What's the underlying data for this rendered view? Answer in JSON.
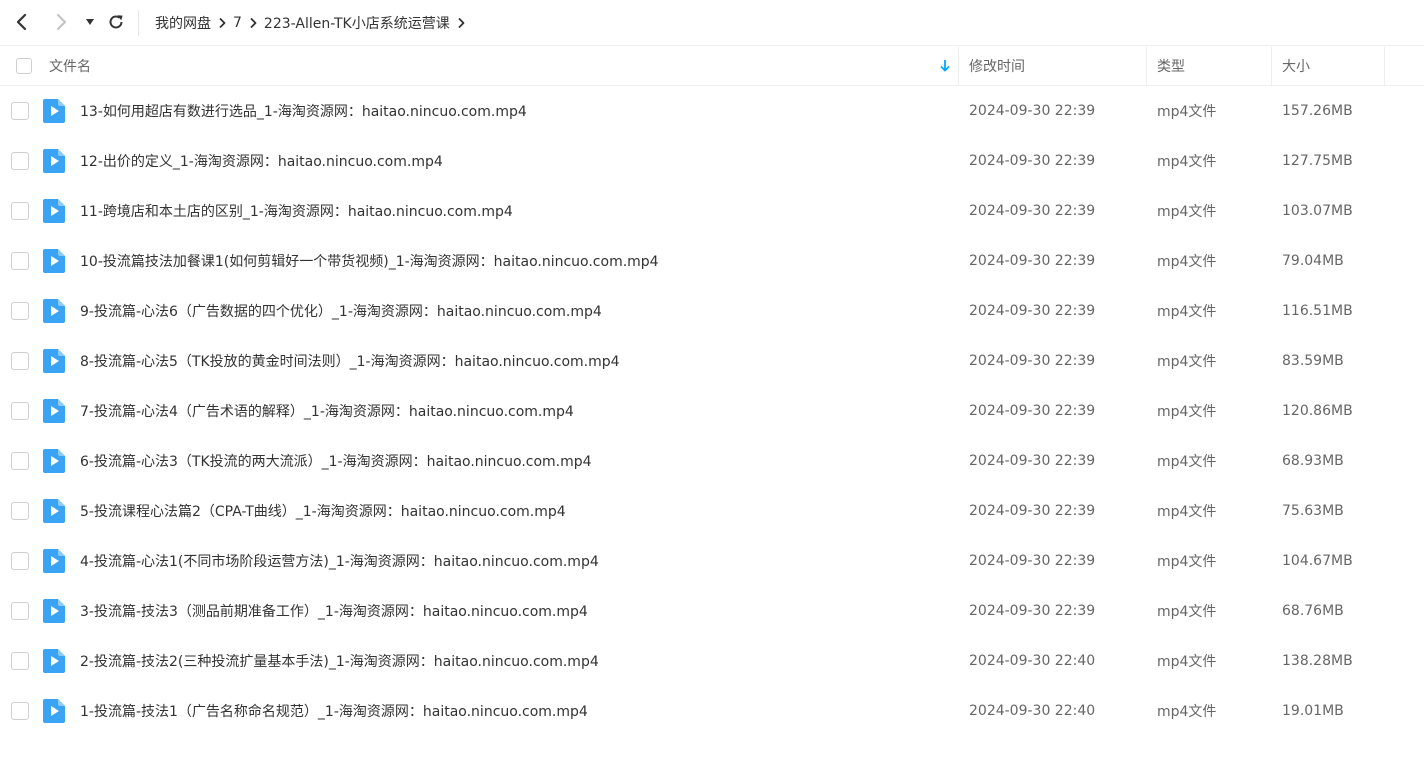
{
  "nav": {
    "back_icon": "chevron-left-icon",
    "forward_icon": "chevron-right-icon",
    "history_icon": "caret-down-icon",
    "refresh_icon": "refresh-icon"
  },
  "breadcrumb": [
    {
      "label": "我的网盘"
    },
    {
      "label": "7"
    },
    {
      "label": "223-Allen-TK小店系统运营课"
    }
  ],
  "columns": {
    "name": "文件名",
    "modified": "修改时间",
    "type": "类型",
    "size": "大小"
  },
  "colors": {
    "accent": "#06a7ff",
    "file_icon": "#3aa3f4"
  },
  "files": [
    {
      "name": "13-如何用超店有数进行选品_1-海淘资源网：haitao.nincuo.com.mp4",
      "modified": "2024-09-30 22:39",
      "type": "mp4文件",
      "size": "157.26MB"
    },
    {
      "name": "12-出价的定义_1-海淘资源网：haitao.nincuo.com.mp4",
      "modified": "2024-09-30 22:39",
      "type": "mp4文件",
      "size": "127.75MB"
    },
    {
      "name": "11-跨境店和本土店的区别_1-海淘资源网：haitao.nincuo.com.mp4",
      "modified": "2024-09-30 22:39",
      "type": "mp4文件",
      "size": "103.07MB"
    },
    {
      "name": "10-投流篇技法加餐课1(如何剪辑好一个带货视频)_1-海淘资源网：haitao.nincuo.com.mp4",
      "modified": "2024-09-30 22:39",
      "type": "mp4文件",
      "size": "79.04MB"
    },
    {
      "name": "9-投流篇-心法6（广告数据的四个优化）_1-海淘资源网：haitao.nincuo.com.mp4",
      "modified": "2024-09-30 22:39",
      "type": "mp4文件",
      "size": "116.51MB"
    },
    {
      "name": "8-投流篇-心法5（TK投放的黄金时间法则）_1-海淘资源网：haitao.nincuo.com.mp4",
      "modified": "2024-09-30 22:39",
      "type": "mp4文件",
      "size": "83.59MB"
    },
    {
      "name": "7-投流篇-心法4（广告术语的解释）_1-海淘资源网：haitao.nincuo.com.mp4",
      "modified": "2024-09-30 22:39",
      "type": "mp4文件",
      "size": "120.86MB"
    },
    {
      "name": "6-投流篇-心法3（TK投流的两大流派）_1-海淘资源网：haitao.nincuo.com.mp4",
      "modified": "2024-09-30 22:39",
      "type": "mp4文件",
      "size": "68.93MB"
    },
    {
      "name": "5-投流课程心法篇2（CPA-T曲线）_1-海淘资源网：haitao.nincuo.com.mp4",
      "modified": "2024-09-30 22:39",
      "type": "mp4文件",
      "size": "75.63MB"
    },
    {
      "name": "4-投流篇-心法1(不同市场阶段运营方法)_1-海淘资源网：haitao.nincuo.com.mp4",
      "modified": "2024-09-30 22:39",
      "type": "mp4文件",
      "size": "104.67MB"
    },
    {
      "name": "3-投流篇-技法3（测品前期准备工作）_1-海淘资源网：haitao.nincuo.com.mp4",
      "modified": "2024-09-30 22:39",
      "type": "mp4文件",
      "size": "68.76MB"
    },
    {
      "name": "2-投流篇-技法2(三种投流扩量基本手法)_1-海淘资源网：haitao.nincuo.com.mp4",
      "modified": "2024-09-30 22:40",
      "type": "mp4文件",
      "size": "138.28MB"
    },
    {
      "name": "1-投流篇-技法1（广告名称命名规范）_1-海淘资源网：haitao.nincuo.com.mp4",
      "modified": "2024-09-30 22:40",
      "type": "mp4文件",
      "size": "19.01MB"
    }
  ]
}
